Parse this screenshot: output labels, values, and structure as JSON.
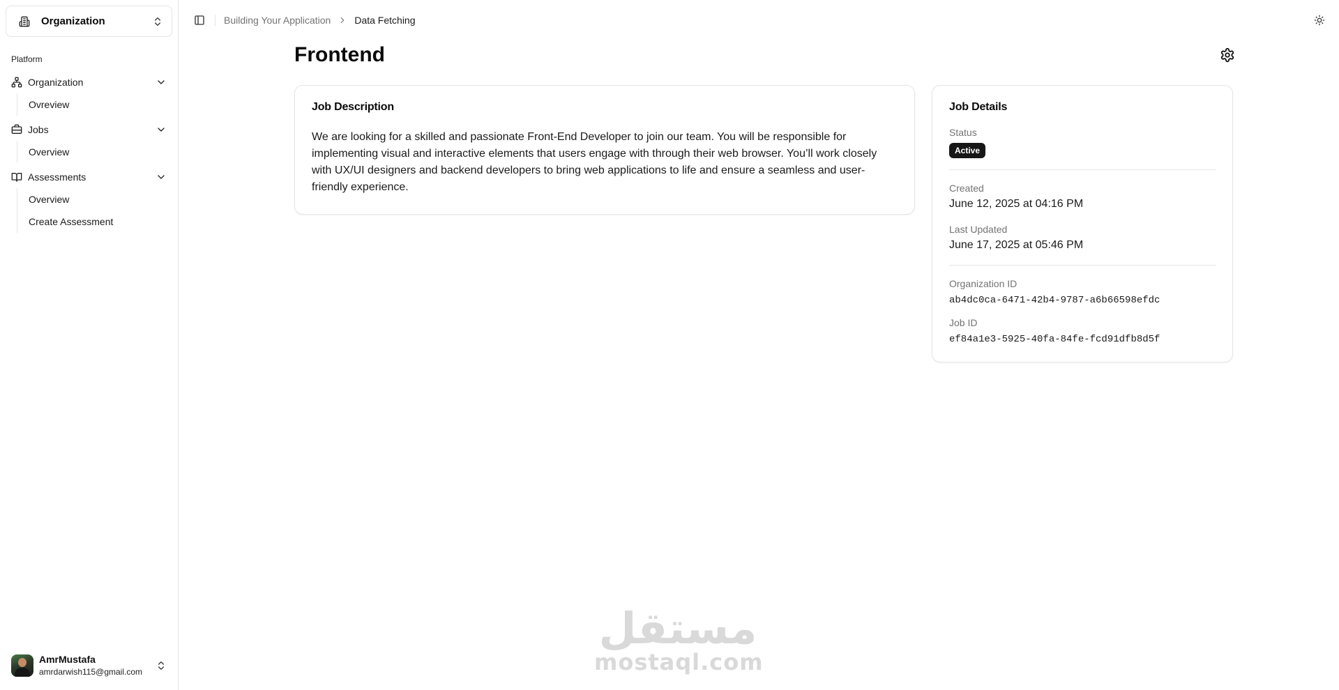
{
  "sidebar": {
    "org_switcher": {
      "name": "Organization",
      "icon": "building-icon"
    },
    "group_label": "Platform",
    "items": [
      {
        "label": "Organization",
        "icon": "network-icon",
        "sub": [
          {
            "label": "Ovreview"
          }
        ]
      },
      {
        "label": "Jobs",
        "icon": "briefcase-icon",
        "sub": [
          {
            "label": "Overview"
          }
        ]
      },
      {
        "label": "Assessments",
        "icon": "book-open-icon",
        "sub": [
          {
            "label": "Overview"
          },
          {
            "label": "Create Assessment"
          }
        ]
      }
    ],
    "user": {
      "name": "AmrMustafa",
      "email": "amrdarwish115@gmail.com"
    }
  },
  "topbar": {
    "breadcrumb": [
      "Building Your Application",
      "Data Fetching"
    ]
  },
  "page": {
    "title": "Frontend",
    "job_description": {
      "title": "Job Description",
      "text": "We are looking for a skilled and passionate Front-End Developer to join our team. You will be responsible for implementing visual and interactive elements that users engage with through their web browser. You’ll work closely with UX/UI designers and backend developers to bring web applications to life and ensure a seamless and user-friendly experience."
    },
    "job_details": {
      "title": "Job Details",
      "status_label": "Status",
      "status_value": "Active",
      "created_label": "Created",
      "created_value": "June 12, 2025 at 04:16 PM",
      "updated_label": "Last Updated",
      "updated_value": "June 17, 2025 at 05:46 PM",
      "org_id_label": "Organization ID",
      "org_id_value": "ab4dc0ca-6471-42b4-9787-a6b66598efdc",
      "job_id_label": "Job ID",
      "job_id_value": "ef84a1e3-5925-40fa-84fe-fcd91dfb8d5f"
    }
  },
  "watermark": {
    "arabic": "مستقل",
    "latin": "mostaql.com"
  },
  "colors": {
    "badge_bg": "#171717",
    "muted_text": "#737373",
    "border": "#e5e5e5"
  }
}
